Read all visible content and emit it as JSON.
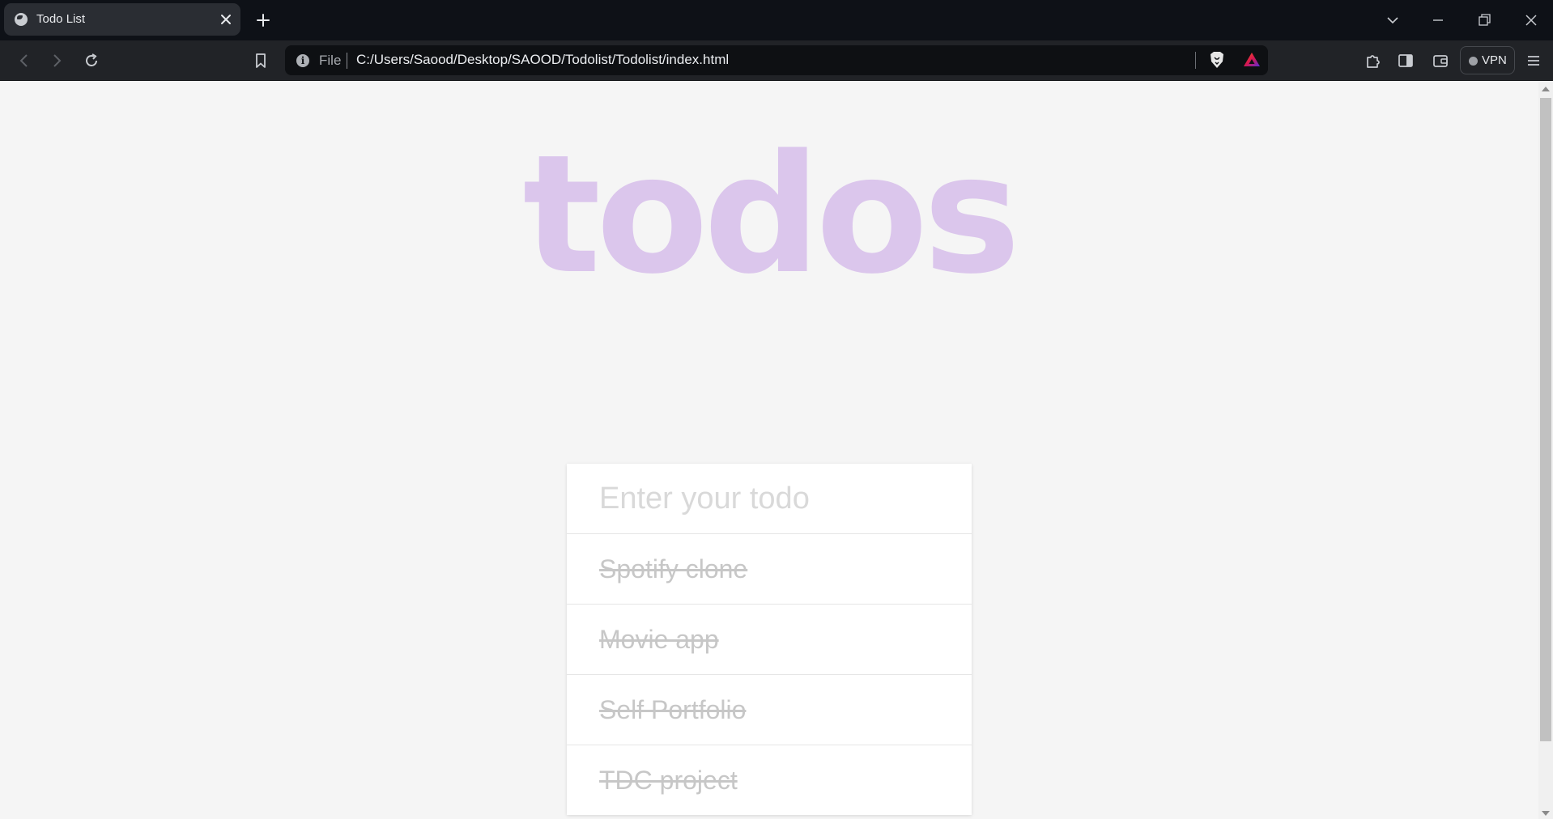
{
  "browser": {
    "tab": {
      "title": "Todo List"
    },
    "address": {
      "scheme_label": "File",
      "url": "C:/Users/Saood/Desktop/SAOOD/Todolist/Todolist/index.html"
    },
    "vpn_label": "VPN",
    "icons": {
      "favicon": "globe-icon",
      "close_tab": "close-icon",
      "new_tab": "plus-icon",
      "back": "arrow-left-icon",
      "forward": "arrow-right-icon",
      "reload": "reload-icon",
      "bookmark": "bookmark-icon",
      "site_info": "info-icon",
      "shields": "brave-lion-icon",
      "rewards": "triangle-icon",
      "extensions": "puzzle-icon",
      "sidebar": "sidebar-icon",
      "wallet": "wallet-icon",
      "menu": "hamburger-menu-icon"
    }
  },
  "app": {
    "title": "todos",
    "input": {
      "placeholder": "Enter your todo",
      "value": ""
    },
    "todos": [
      {
        "text": "Spotify clone",
        "completed": true
      },
      {
        "text": "Movie app",
        "completed": true
      },
      {
        "text": "Self Portfolio",
        "completed": true
      },
      {
        "text": "TDC project",
        "completed": true
      }
    ]
  },
  "colors": {
    "title": "#dbc6ec",
    "page_background": "#f5f5f5",
    "completed_text": "#c7c7c7",
    "browser_frame": "#0e1117"
  }
}
